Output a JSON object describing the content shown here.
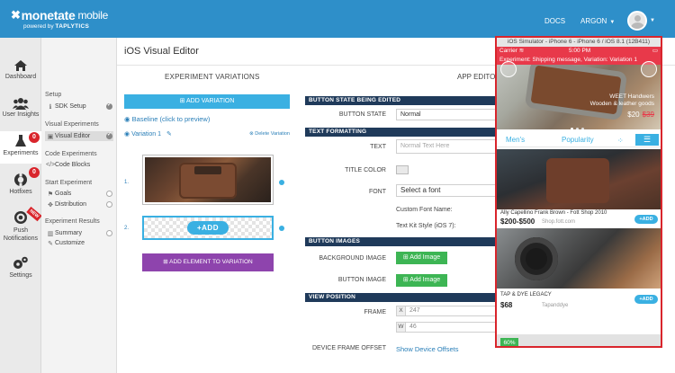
{
  "topbar": {
    "logo_main": "monetate",
    "logo_mobile": "mobile",
    "logo_powered": "powered by",
    "logo_brand": "TAPLYTICS",
    "docs": "DOCS",
    "account": "ARGON"
  },
  "iconnav": {
    "items": [
      {
        "label": "Dashboard",
        "icon": "home-icon"
      },
      {
        "label": "User Insights",
        "icon": "users-icon"
      },
      {
        "label": "Experiments",
        "icon": "flask-icon",
        "badge": "0"
      },
      {
        "label": "Hotfixes",
        "icon": "lifebuoy-icon",
        "badge": "0"
      },
      {
        "label": "Push Notifications",
        "icon": "target-icon",
        "ribbon": "NEW"
      },
      {
        "label": "Settings",
        "icon": "gears-icon"
      }
    ]
  },
  "subnav": {
    "setup_head": "Setup",
    "sdk_setup": "SDK Setup",
    "visual_head": "Visual Experiments",
    "visual_editor": "Visual Editor",
    "code_head": "Code Experiments",
    "code_blocks": "Code Blocks",
    "start_head": "Start Experiment",
    "goals": "Goals",
    "distribution": "Distribution",
    "results_head": "Experiment Results",
    "summary": "Summary",
    "customize": "Customize"
  },
  "main": {
    "title": "iOS Visual Editor",
    "col_variations": "EXPERIMENT VARIATIONS",
    "col_app_editor": "APP EDITOR",
    "add_variation": "ADD VARIATION",
    "baseline": "Baseline (click to preview)",
    "variation": "Variation 1",
    "delete_variation": "Delete Variation",
    "row1": "1.",
    "row2": "2.",
    "add_pill": "+ADD",
    "add_element": "ADD ELEMENT TO VARIATION"
  },
  "editor": {
    "sec_state": "BUTTON STATE BEING EDITED",
    "button_state_label": "BUTTON STATE",
    "button_state_value": "Normal",
    "sec_text": "TEXT FORMATTING",
    "text_label": "TEXT",
    "text_placeholder": "Normal Text Here",
    "title_color_label": "TITLE COLOR",
    "font_label": "FONT",
    "font_value": "Select a font",
    "custom_font": "Custom Font Name:",
    "text_kit": "Text Kit Style (iOS 7):",
    "sec_images": "BUTTON IMAGES",
    "bg_image_label": "BACKGROUND IMAGE",
    "btn_image_label": "BUTTON IMAGE",
    "add_image": "Add Image",
    "sec_view": "VIEW POSITION",
    "frame_label": "FRAME",
    "x_label": "X",
    "x_value": "247",
    "w_label": "W",
    "w_value": "46",
    "offset_label": "DEVICE FRAME OFFSET",
    "offset_link": "Show Device Offsets"
  },
  "simulator": {
    "title": "iOS Simulator - iPhone 6 - iPhone 6 / iOS 8.1 (12B411)",
    "carrier": "Carrier",
    "time": "5:00 PM",
    "banner": "Experiment: Shipping message, Variation: Variation 1",
    "hero_line1": "WEET Handwers",
    "hero_line2": "Wooden & leather goods",
    "hero_price": "$20",
    "hero_old_price": "$39",
    "tab_men": "Men's",
    "tab_popularity": "Popularity",
    "p1_title": "Ally Capellino Frank Brown - Fott Shop 2010",
    "p1_price": "$200-$500",
    "p1_shop": "Shop.fott.com",
    "p2_title": "TAP & DYE LEGACY",
    "p2_price": "$68",
    "p2_shop": "Tapanddye",
    "add": "+ADD",
    "pct": "60%"
  },
  "colors": {
    "topbar": "#2e8fc9",
    "accent": "#3ab0e2",
    "purple": "#8e44ad",
    "green": "#3db554",
    "navy": "#1f3a5a",
    "red": "#d9252c"
  }
}
